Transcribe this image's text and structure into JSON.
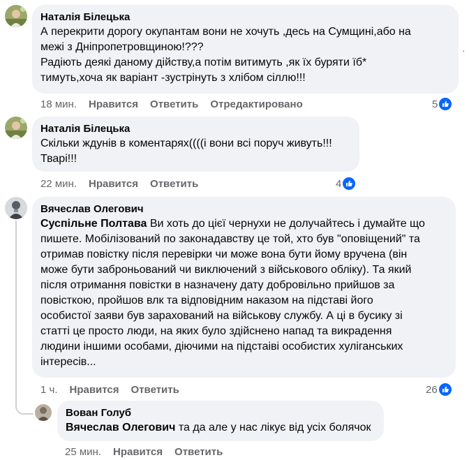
{
  "comments": [
    {
      "author": "Наталія Білецька",
      "lines": [
        "А перекрити дорогу окупантам вони не хочуть ,десь на Сумщині,або на",
        "межі з Дніпропетровщиною!???",
        "Радіють деякі даному дійству,а потім витимуть ,як їх буряти їб*",
        "тимуть,хоча як варіант -зустрінуть з хлібом сіллю!!!"
      ],
      "time": "18 мин.",
      "like_label": "Нравится",
      "reply_label": "Ответить",
      "edited_label": "Отредактировано",
      "reactions": "5"
    },
    {
      "author": "Наталія Білецька",
      "lines": [
        "Скільки ждунів в коментарях((((і вони всі поруч живуть!!!",
        "Тварі!!!"
      ],
      "time": "22 мин.",
      "like_label": "Нравится",
      "reply_label": "Ответить",
      "reactions": "4"
    },
    {
      "author": "Вячеслав Олегович",
      "tag": "Суспільне Полтава",
      "first_line_rest": " Ви хоть до цієї чернухи не долучайтесь і думайте що",
      "lines": [
        "пишете. Мобілізований по законадавству це той, хто був \"оповіщений\" та",
        "отримав повістку після перевірки чи може вона бути йому вручена (він",
        "може бути заброньований чи виключений з військового обліку). Та який",
        "після отримання повістки в назначену дату добровільно прийшов за",
        "повісткою, пройшов влк та відповідним наказом на підставі його",
        "особистої заяви був зарахований на військову службу. А ці в бусику зі",
        "статті це просто люди, на яких було здійснено напад та викрадення",
        "людини іншими особами, діючими на підстаіві особистих хуліганських",
        "інтересів..."
      ],
      "time": "1 ч.",
      "like_label": "Нравится",
      "reply_label": "Ответить",
      "reactions": "26"
    },
    {
      "author": "Вован Голуб",
      "tag": "Вячеслав Олегович",
      "text_rest": " та да але у нас лікує від усіх болячок",
      "time": "25 мин.",
      "like_label": "Нравится",
      "reply_label": "Ответить"
    }
  ],
  "icons": {
    "like": "thumbs-up-icon",
    "like_color": "#0866ff"
  }
}
